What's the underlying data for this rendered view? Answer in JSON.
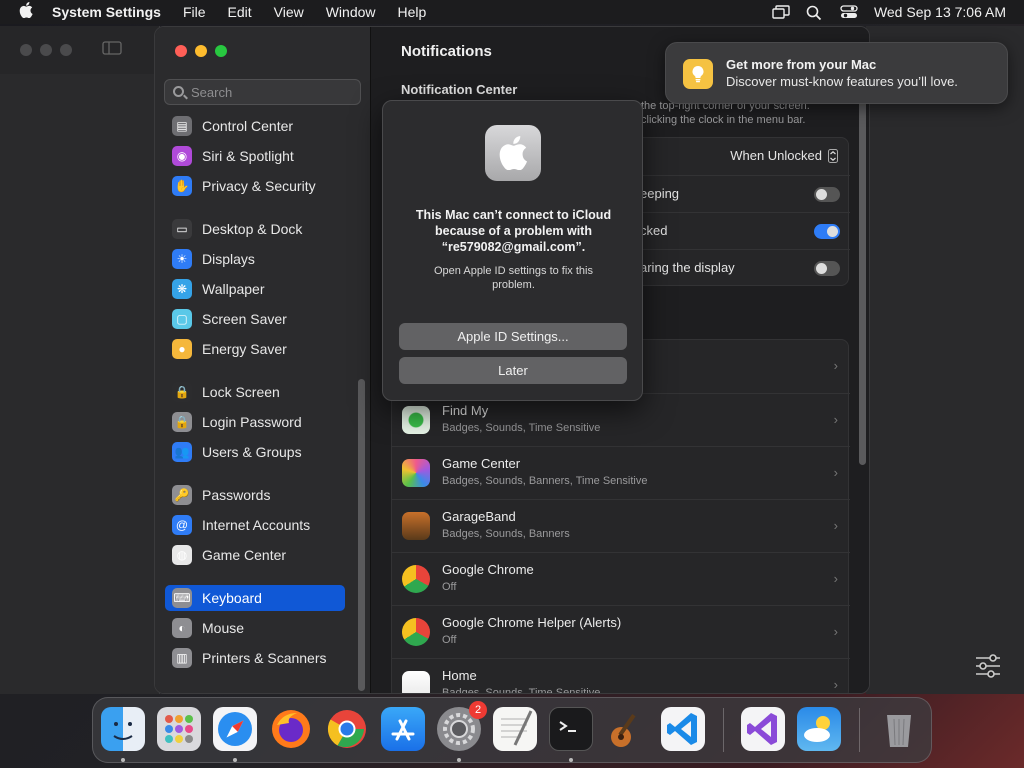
{
  "menubar": {
    "app_name": "System Settings",
    "menus": [
      "File",
      "Edit",
      "View",
      "Window",
      "Help"
    ],
    "clock": "Wed Sep 13  7:06 AM"
  },
  "sidebar": {
    "search_placeholder": "Search",
    "items": [
      {
        "label": "Control Center",
        "color": "#6e6e72"
      },
      {
        "label": "Siri & Spotlight",
        "color": "#b04ad9"
      },
      {
        "label": "Privacy & Security",
        "color": "#2f7cf6"
      },
      {
        "label": "Desktop & Dock",
        "color": "#3a3a3c"
      },
      {
        "label": "Displays",
        "color": "#2f7cf6"
      },
      {
        "label": "Wallpaper",
        "color": "#35a3e8"
      },
      {
        "label": "Screen Saver",
        "color": "#5ac8e8"
      },
      {
        "label": "Energy Saver",
        "color": "#f5b73b"
      },
      {
        "label": "Lock Screen",
        "color": "#2c2c2e"
      },
      {
        "label": "Login Password",
        "color": "#8e8e92"
      },
      {
        "label": "Users & Groups",
        "color": "#2f7cf6"
      },
      {
        "label": "Passwords",
        "color": "#8e8e92"
      },
      {
        "label": "Internet Accounts",
        "color": "#2f7cf6"
      },
      {
        "label": "Game Center",
        "color": "#e8e8e8"
      },
      {
        "label": "Keyboard",
        "color": "#8e8e92"
      },
      {
        "label": "Mouse",
        "color": "#8e8e92"
      },
      {
        "label": "Printers & Scanners",
        "color": "#8e8e92"
      }
    ],
    "active_item": "Keyboard"
  },
  "main": {
    "title": "Notifications",
    "section_title": "Notification Center",
    "section_desc": "the top-right corner of your screen. clicking the clock in the menu bar.",
    "previews_value": "When Unlocked",
    "toggle_rows": [
      {
        "label": "eeping",
        "on": false
      },
      {
        "label": "cked",
        "on": true
      },
      {
        "label": "aring the display",
        "on": false
      }
    ],
    "apps": [
      {
        "name": "Find My",
        "sub": "Badges, Sounds, Time Sensitive",
        "icon": "find-my-icon"
      },
      {
        "name": "Game Center",
        "sub": "Badges, Sounds, Banners, Time Sensitive",
        "icon": "game-center-icon"
      },
      {
        "name": "GarageBand",
        "sub": "Badges, Sounds, Banners",
        "icon": "garageband-icon"
      },
      {
        "name": "Google Chrome",
        "sub": "Off",
        "icon": "chrome-icon"
      },
      {
        "name": "Google Chrome Helper (Alerts)",
        "sub": "Off",
        "icon": "chrome-icon"
      },
      {
        "name": "Home",
        "sub": "Badges, Sounds, Time Sensitive",
        "icon": "home-icon"
      }
    ]
  },
  "alert": {
    "message": "This Mac can’t connect to iCloud because of a problem with “re579082@gmail.com”.",
    "info": "Open Apple ID settings to fix this problem.",
    "primary_button": "Apple ID Settings...",
    "secondary_button": "Later"
  },
  "banner": {
    "title": "Get more from your Mac",
    "body": "Discover must-know features you’ll love."
  },
  "dock": {
    "system_settings_badge": "2",
    "apps": [
      "Finder",
      "Launchpad",
      "Safari",
      "Firefox",
      "Google Chrome",
      "App Store",
      "System Settings",
      "TextEdit",
      "Terminal",
      "GarageBand",
      "Visual Studio Code",
      "Visual Studio",
      "Weather",
      "Trash"
    ]
  }
}
